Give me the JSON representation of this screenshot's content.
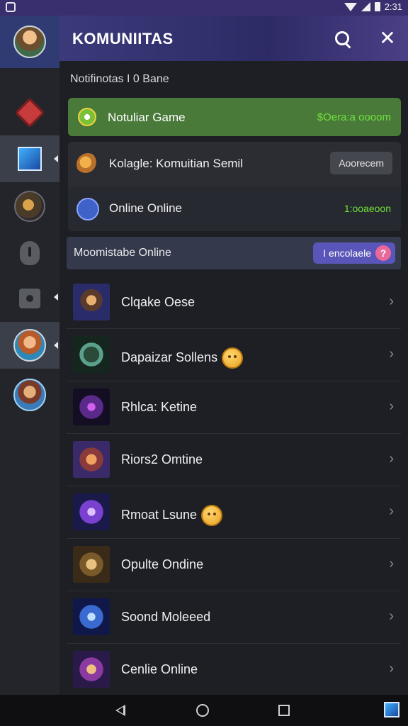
{
  "status_bar": {
    "time": "2:31"
  },
  "header": {
    "title": "KOMUNIITAS"
  },
  "section": {
    "label": "Notifinotas I 0 Bane"
  },
  "game_bar": {
    "label": "Notuliar Game",
    "status": "$Oera:a oooom"
  },
  "card": {
    "row1": {
      "label": "Kolagle: Komuitian Semil",
      "button": "Aoorecem"
    },
    "row2": {
      "label": "Online Online",
      "count": "1:ooaeoon"
    }
  },
  "moderation": {
    "label": "Moomistabe Online",
    "pill": "I encolaele",
    "help": "?"
  },
  "list": [
    {
      "name": "Clqake Oese",
      "emoji": false
    },
    {
      "name": "Dapaizar Sollens",
      "emoji": true
    },
    {
      "name": "Rhlca: Ketine",
      "emoji": false
    },
    {
      "name": "Riors2 Omtine",
      "emoji": false
    },
    {
      "name": "Rmoat Lsune",
      "emoji": true
    },
    {
      "name": "Opulte Ondine",
      "emoji": false
    },
    {
      "name": "Soond Moleeed",
      "emoji": false
    },
    {
      "name": "Cenlie Online",
      "emoji": false
    }
  ],
  "colors": {
    "accent": "#3b3a7a",
    "online_green": "#6fe03a",
    "game_bar_bg": "#4a7a3a",
    "pill_bg": "#5a55b8"
  },
  "icons": {
    "rail": [
      "avatar",
      "red-diamond-icon",
      "blue-square-icon",
      "warrior-icon",
      "shield-icon",
      "gear-icon",
      "avatar",
      "avatar"
    ],
    "nav": [
      "back-icon",
      "home-icon",
      "recents-icon",
      "app-icon"
    ]
  }
}
